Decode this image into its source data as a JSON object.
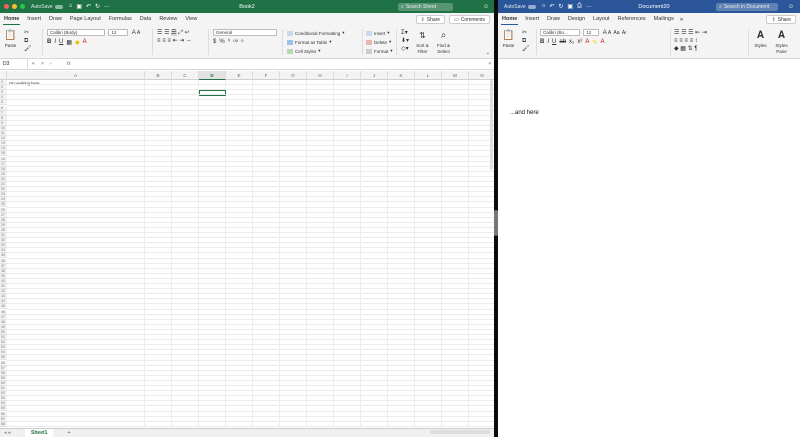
{
  "excel": {
    "autosave_label": "AutoSave",
    "toggle_state": "OFF",
    "title": "Book2",
    "search_placeholder": "Search Sheet",
    "tabs": [
      "Home",
      "Insert",
      "Draw",
      "Page Layout",
      "Formulas",
      "Data",
      "Review",
      "View"
    ],
    "active_tab": "Home",
    "share_label": "Share",
    "comments_label": "Comments",
    "ribbon": {
      "paste_label": "Paste",
      "font_name": "Calibri (Body)",
      "font_size": "12",
      "number_format": "General",
      "conditional_formatting": "Conditional Formatting",
      "format_as_table": "Format as Table",
      "cell_styles": "Cell Styles",
      "insert": "Insert",
      "delete": "Delete",
      "format": "Format",
      "sort_filter": "Sort &",
      "sort_filter2": "Filter",
      "find_select": "Find &",
      "find_select2": "Select",
      "bold": "B",
      "italic": "I",
      "underline": "U",
      "dollar": "$",
      "percent": "%"
    },
    "name_box": "D3",
    "fx_label": "fx",
    "columns": [
      "A",
      "B",
      "C",
      "D",
      "E",
      "F",
      "G",
      "H",
      "I",
      "J",
      "K",
      "L",
      "M",
      "N"
    ],
    "active_column": "D",
    "cell_a1": "I'm working here...",
    "sheet_tab": "Sheet1",
    "add_sheet": "+"
  },
  "word": {
    "autosave_label": "AutoSave",
    "toggle_state": "OFF",
    "title": "Document20",
    "search_placeholder": "Search in Document",
    "tabs": [
      "Home",
      "Insert",
      "Draw",
      "Design",
      "Layout",
      "References",
      "Mailings"
    ],
    "active_tab": "Home",
    "share_label": "Share",
    "ribbon": {
      "paste_label": "Paste",
      "font_name": "Calibri (Bo...",
      "font_size": "12",
      "styles_label": "Styles",
      "styles_pane_label": "Styles",
      "styles_pane_label2": "Pane"
    },
    "body_text": "...and here"
  },
  "colors": {
    "excel_green": "#1f7245",
    "word_blue": "#2b579a",
    "divider": "#0b0b0b"
  }
}
